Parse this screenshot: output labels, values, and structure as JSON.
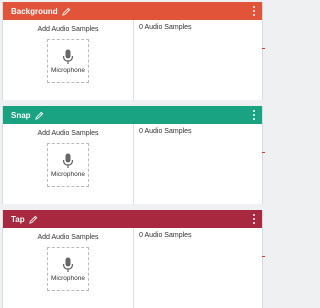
{
  "cards": [
    {
      "title": "Background",
      "color": "#e2543a",
      "add_label": "Add Audio Samples",
      "mic_label": "Microphone",
      "samples_label": "0 Audio Samples"
    },
    {
      "title": "Snap",
      "color": "#19a382",
      "add_label": "Add Audio Samples",
      "mic_label": "Microphone",
      "samples_label": "0 Audio Samples"
    },
    {
      "title": "Tap",
      "color": "#a8283f",
      "add_label": "Add Audio Samples",
      "mic_label": "Microphone",
      "samples_label": "0 Audio Samples"
    }
  ],
  "icons": {
    "edit": "pencil-icon",
    "menu": "more-vert-icon",
    "mic": "microphone-icon"
  }
}
